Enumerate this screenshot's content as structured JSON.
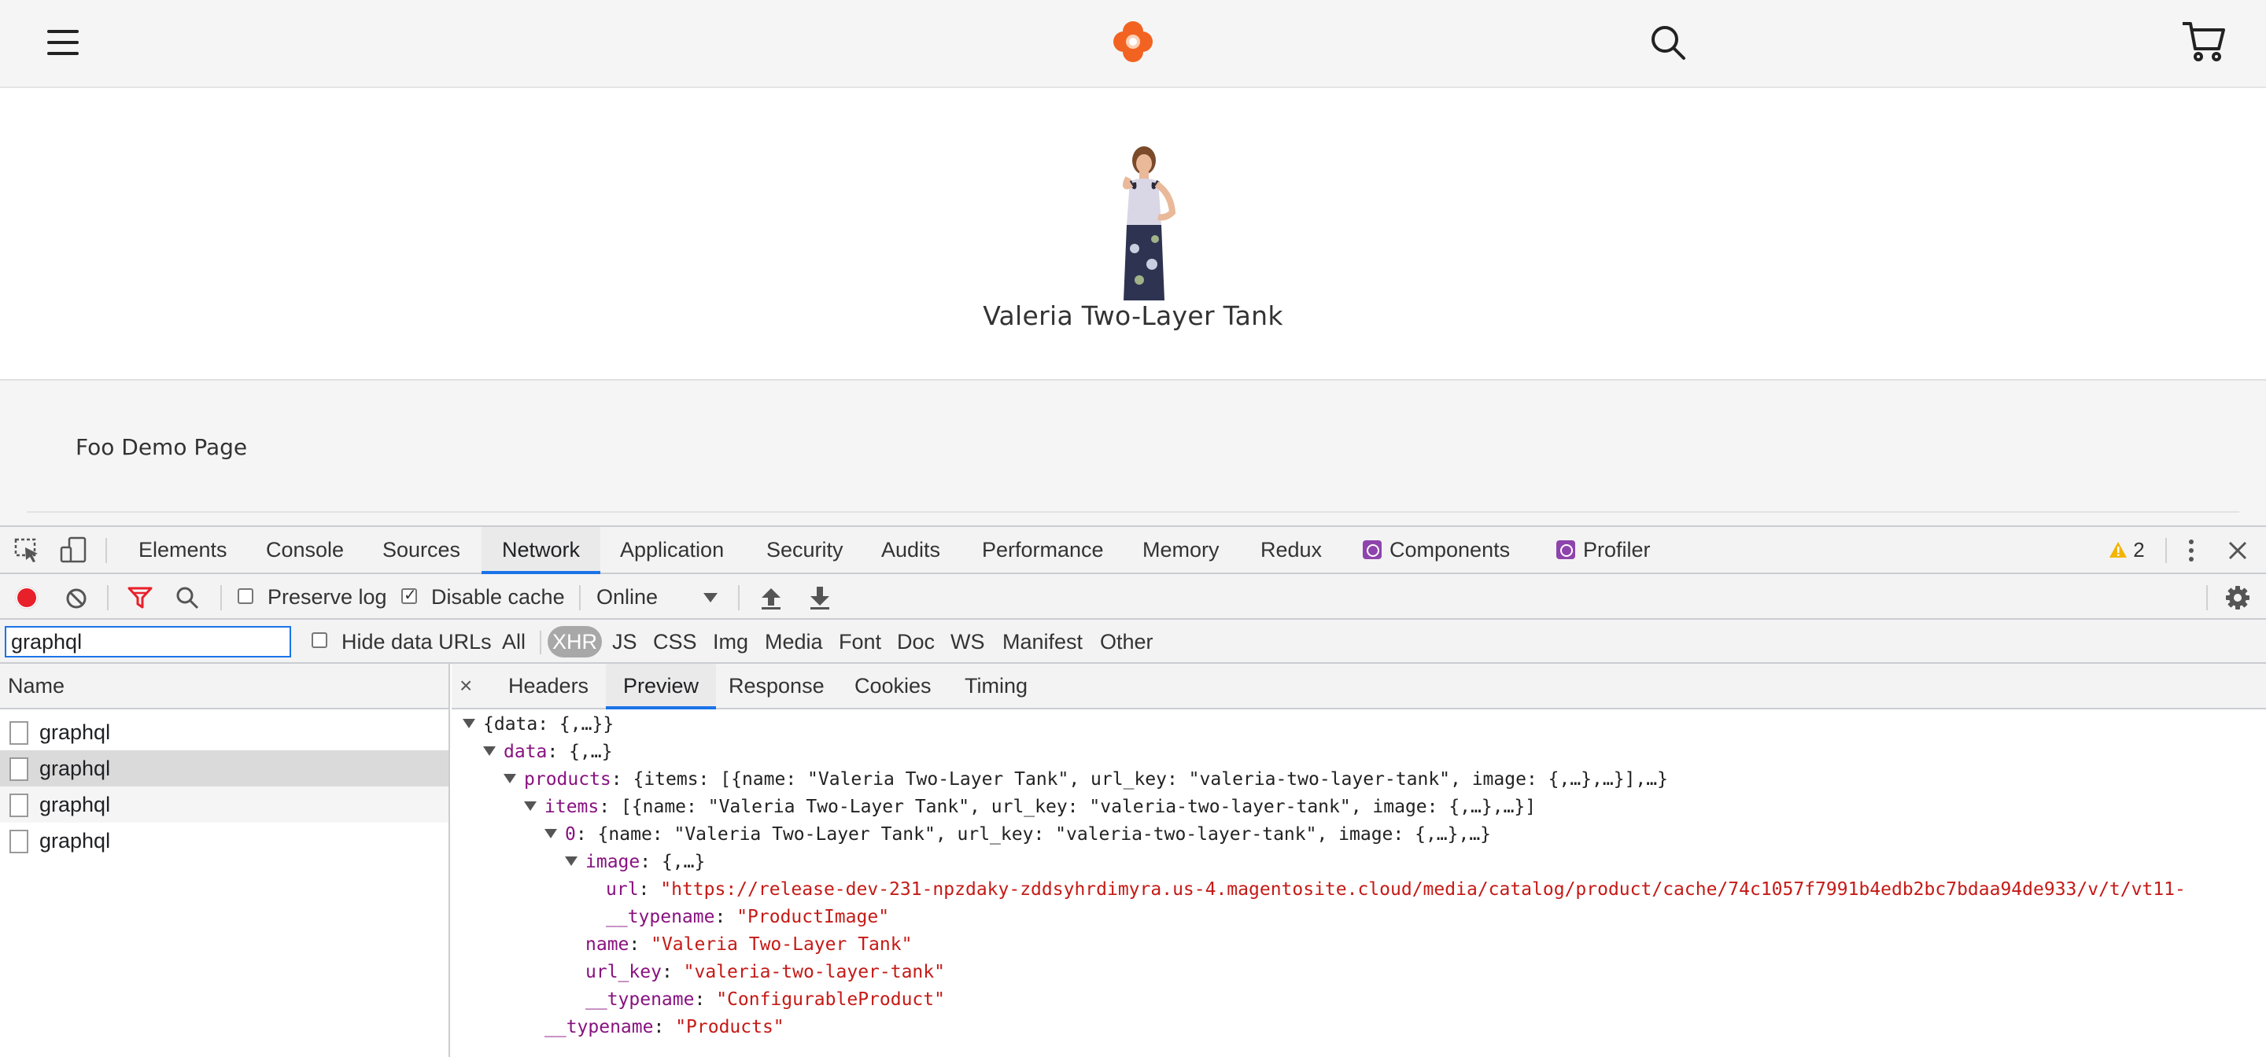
{
  "storefront": {
    "header": {
      "menu_icon": "hamburger-menu-icon",
      "logo_icon": "brand-logo-icon",
      "search_icon": "search-icon",
      "cart_icon": "cart-icon",
      "brand_color": "#f26322"
    },
    "product": {
      "name": "Valeria Two-Layer Tank"
    },
    "footer": {
      "text": "Foo Demo Page"
    }
  },
  "devtools": {
    "tabs": [
      "Elements",
      "Console",
      "Sources",
      "Network",
      "Application",
      "Security",
      "Audits",
      "Performance",
      "Memory",
      "Redux",
      "Components",
      "Profiler"
    ],
    "active_tab": "Network",
    "warning_count": "2",
    "toolbar": {
      "preserve_log": "Preserve log",
      "disable_cache": "Disable cache",
      "throttling": "Online"
    },
    "filter": {
      "value": "graphql",
      "hide_data_urls": "Hide data URLs",
      "types": [
        "All",
        "XHR",
        "JS",
        "CSS",
        "Img",
        "Media",
        "Font",
        "Doc",
        "WS",
        "Manifest",
        "Other"
      ],
      "active_type": "XHR"
    },
    "requests": {
      "header": "Name",
      "rows": [
        "graphql",
        "graphql",
        "graphql",
        "graphql"
      ]
    },
    "detail": {
      "close": "×",
      "tabs": [
        "Headers",
        "Preview",
        "Response",
        "Cookies",
        "Timing"
      ],
      "active_tab": "Preview",
      "preview": {
        "l0": "{data: {,…}}",
        "l1_key": "data",
        "l1_val": ": {,…}",
        "l2_key": "products",
        "l2_val": ": {items: [{name: \"Valeria Two-Layer Tank\", url_key: \"valeria-two-layer-tank\", image: {,…},…}],…}",
        "l3_key": "items",
        "l3_val": ": [{name: \"Valeria Two-Layer Tank\", url_key: \"valeria-two-layer-tank\", image: {,…},…}]",
        "l4_key": "0",
        "l4_val": ": {name: \"Valeria Two-Layer Tank\", url_key: \"valeria-two-layer-tank\", image: {,…},…}",
        "l5_key": "image",
        "l5_val": ": {,…}",
        "l6_key": "url",
        "l6_val": "\"https://release-dev-231-npzdaky-zddsyhrdimyra.us-4.magentosite.cloud/media/catalog/product/cache/74c1057f7991b4edb2bc7bdaa94de933/v/t/vt11-",
        "l7_key": "__typename",
        "l7_val": "\"ProductImage\"",
        "l8_key": "name",
        "l8_val": "\"Valeria Two-Layer Tank\"",
        "l9_key": "url_key",
        "l9_val": "\"valeria-two-layer-tank\"",
        "l10_key": "__typename",
        "l10_val": "\"ConfigurableProduct\"",
        "l11_key": "__typename",
        "l11_val": "\"Products\""
      }
    }
  }
}
